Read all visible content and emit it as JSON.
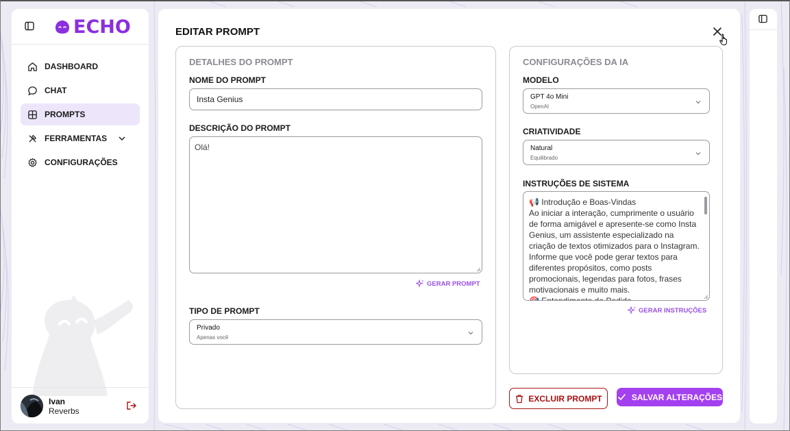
{
  "brand": {
    "name": "ECHO",
    "color": "#8b2fe0"
  },
  "sidebar": {
    "items": [
      {
        "label": "DASHBOARD",
        "icon": "home-icon",
        "active": false
      },
      {
        "label": "CHAT",
        "icon": "chat-icon",
        "active": false
      },
      {
        "label": "PROMPTS",
        "icon": "grid-icon",
        "active": true
      },
      {
        "label": "FERRAMENTAS",
        "icon": "tools-icon",
        "active": false,
        "expandable": true
      },
      {
        "label": "CONFIGURAÇÕES",
        "icon": "gear-icon",
        "active": false
      }
    ],
    "user": {
      "first_name": "Ivan",
      "last_name": "Reverbs"
    }
  },
  "modal": {
    "title": "EDITAR PROMPT",
    "details": {
      "heading": "DETALHES DO PROMPT",
      "name_label": "NOME DO PROMPT",
      "name_value": "Insta Genius",
      "description_label": "DESCRIÇÃO DO PROMPT",
      "description_value": "Olá!",
      "generate_prompt_label": "GERAR PROMPT",
      "type_label": "TIPO DE PROMPT",
      "type_value": "Privado",
      "type_sub": "Apenas você"
    },
    "ai_config": {
      "heading": "CONFIGURAÇÕES DA IA",
      "model_label": "MODELO",
      "model_value": "GPT 4o Mini",
      "model_sub": "OpenAI",
      "creativity_label": "CRIATIVIDADE",
      "creativity_value": "Natural",
      "creativity_sub": "Equilibrado",
      "instructions_label": "INSTRUÇÕES DE SISTEMA",
      "instructions_lines": [
        "📢 Introdução e Boas-Vindas",
        "Ao iniciar a interação, cumprimente o usuário de forma amigável e apresente-se como Insta Genius, um assistente especializado na criação de textos otimizados para o Instagram.",
        "Informe que você pode gerar textos para diferentes propósitos, como posts promocionais, legendas para fotos, frases motivacionais e muito mais.",
        "🎯 Entendimento do Pedido"
      ],
      "generate_instructions_label": "GERAR INSTRUÇÕES"
    },
    "actions": {
      "delete_label": "EXCLUIR PROMPT",
      "save_label": "SALVAR ALTERAÇÕES"
    }
  },
  "colors": {
    "accent": "#a340f0",
    "danger": "#aa1111",
    "active_bg": "#ede6fb"
  }
}
